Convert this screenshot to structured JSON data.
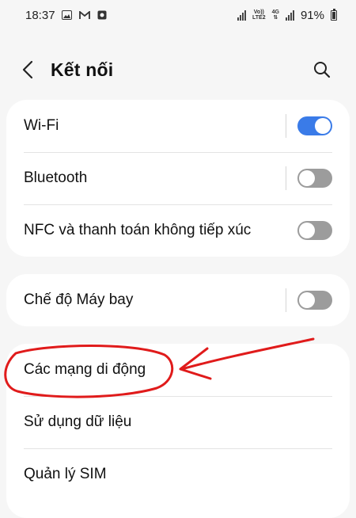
{
  "status_bar": {
    "time": "18:37",
    "network_top": "Vo))",
    "network_bottom": "LTE2",
    "network_type": "4G",
    "battery": "91%",
    "left_icons": [
      "gallery-icon",
      "gmail-icon",
      "camera-app-icon"
    ],
    "right_icons": [
      "signal-icon",
      "volte-icon",
      "4g-data-icon",
      "signal-icon",
      "battery-icon"
    ]
  },
  "header": {
    "title": "Kết nối",
    "back_icon": "chevron-left-icon",
    "search_icon": "search-icon"
  },
  "groups": [
    {
      "items": [
        {
          "label": "Wi-Fi",
          "toggle": true,
          "state": "on"
        },
        {
          "label": "Bluetooth",
          "toggle": true,
          "state": "off"
        },
        {
          "label": "NFC và thanh toán không tiếp xúc",
          "toggle": true,
          "state": "off"
        }
      ]
    },
    {
      "items": [
        {
          "label": "Chế độ Máy bay",
          "toggle": true,
          "state": "off"
        }
      ]
    },
    {
      "items": [
        {
          "label": "Các mạng di động",
          "toggle": false
        },
        {
          "label": "Sử dụng dữ liệu",
          "toggle": false
        },
        {
          "label": "Quản lý SIM",
          "toggle": false
        }
      ]
    }
  ],
  "annotation": {
    "shape": "ellipse-with-arrow",
    "color": "#e01b1b",
    "target": "Các mạng di động"
  },
  "colors": {
    "background": "#f6f6f6",
    "card": "#ffffff",
    "toggle_on": "#3a7be8",
    "toggle_off": "#9c9c9c"
  }
}
